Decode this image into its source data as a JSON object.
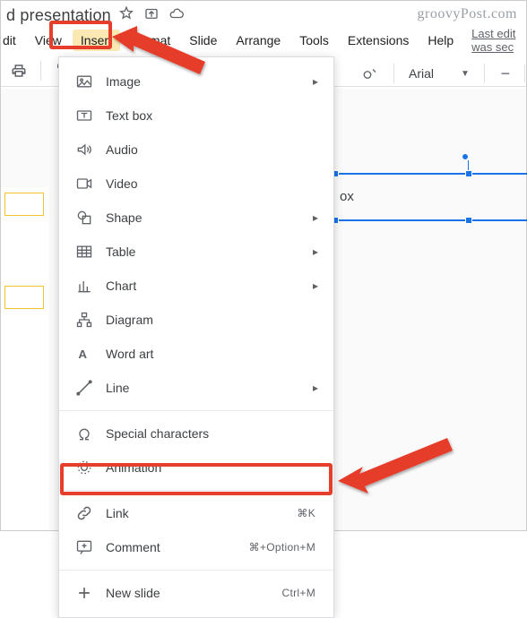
{
  "watermark": "groovyPost.com",
  "title": {
    "text": "d presentation"
  },
  "menubar": {
    "items": [
      {
        "label": "dit"
      },
      {
        "label": "View"
      },
      {
        "label": "Insert",
        "active": true
      },
      {
        "label": "Format"
      },
      {
        "label": "Slide"
      },
      {
        "label": "Arrange"
      },
      {
        "label": "Tools"
      },
      {
        "label": "Extensions"
      },
      {
        "label": "Help"
      }
    ],
    "last_edit": "Last edit was sec"
  },
  "toolbar_right": {
    "font": "Arial"
  },
  "dropdown": {
    "groups": [
      [
        {
          "icon": "image",
          "label": "Image",
          "submenu": true
        },
        {
          "icon": "textbox",
          "label": "Text box"
        },
        {
          "icon": "audio",
          "label": "Audio"
        },
        {
          "icon": "video",
          "label": "Video"
        },
        {
          "icon": "shape",
          "label": "Shape",
          "submenu": true
        },
        {
          "icon": "table",
          "label": "Table",
          "submenu": true
        },
        {
          "icon": "chart",
          "label": "Chart",
          "submenu": true
        },
        {
          "icon": "diagram",
          "label": "Diagram"
        },
        {
          "icon": "wordart",
          "label": "Word art"
        },
        {
          "icon": "line",
          "label": "Line",
          "submenu": true
        }
      ],
      [
        {
          "icon": "special",
          "label": "Special characters"
        },
        {
          "icon": "animation",
          "label": "Animation"
        }
      ],
      [
        {
          "icon": "link",
          "label": "Link",
          "shortcut": "⌘K"
        },
        {
          "icon": "comment",
          "label": "Comment",
          "shortcut": "⌘+Option+M"
        }
      ],
      [
        {
          "icon": "newslide",
          "label": "New slide",
          "shortcut": "Ctrl+M"
        }
      ]
    ]
  },
  "canvas": {
    "visible_text": "ox"
  }
}
